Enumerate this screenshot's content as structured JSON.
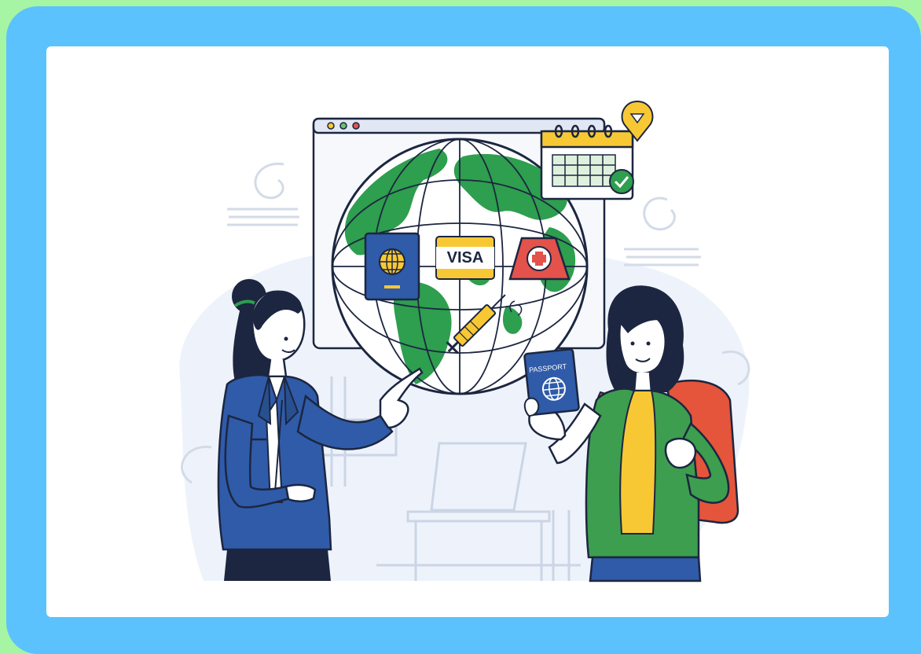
{
  "illustration": {
    "visa_label": "VISA",
    "passport_label": "PASSPORT",
    "colors": {
      "outer_background": "#a6f5a5",
      "frame": "#5bc2fd",
      "card": "#ffffff",
      "globe_ocean": "#ffffff",
      "land": "#2e9e4f",
      "outline": "#1c2640",
      "blazer": "#2f5ba9",
      "visa_yellow": "#f8c834",
      "medical_red": "#e3524b",
      "shirt_green": "#3d9e4f",
      "backpack": "#e4553b"
    },
    "icons": [
      "globe-icon",
      "passport-icon",
      "visa-card-icon",
      "medical-kit-icon",
      "syringe-icon",
      "calendar-icon",
      "location-pin-icon",
      "checkmark-icon"
    ]
  }
}
